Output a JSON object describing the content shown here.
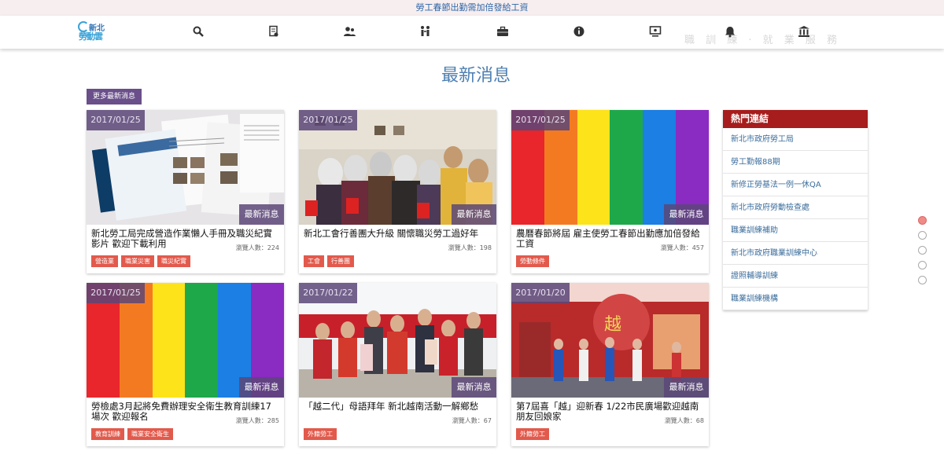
{
  "ticker": "勞工春節出勤需加倍發給工資",
  "logo": {
    "line1": "新北",
    "line2": "勞動雲"
  },
  "nav": [
    "search-icon",
    "document-icon",
    "people-icon",
    "workers-icon",
    "briefcase-icon",
    "info-icon",
    "monitor-icon",
    "bell-icon",
    "building-icon"
  ],
  "faded_text": "職 訓 練 · 就 業 服 務",
  "page_title": "最新消息",
  "more_button": "更多最新消息",
  "cards": [
    {
      "date": "2017/01/25",
      "category": "最新消息",
      "title": "新北勞工局完成營造作業懶人手冊及職災紀實影片 歡迎下載利用",
      "views": "瀏覽人數：224",
      "tags": [
        "營造業",
        "職業災害",
        "職災紀實"
      ],
      "image": "booklet-photo"
    },
    {
      "date": "2017/01/25",
      "category": "最新消息",
      "title": "新北工會行善團大升級 關懷職災勞工過好年",
      "views": "瀏覽人數：198",
      "tags": [
        "工會",
        "行善團"
      ],
      "image": "group-photo"
    },
    {
      "date": "2017/01/25",
      "category": "最新消息",
      "title": "農曆春節將屆 雇主使勞工春節出勤應加倍發給工資",
      "views": "瀏覽人數：457",
      "tags": [
        "勞動條件"
      ],
      "image": "rainbow"
    },
    {
      "date": "2017/01/25",
      "category": "最新消息",
      "title": "勞檢處3月起將免費辦理安全衛生教育訓練17場次 歡迎報名",
      "views": "瀏覽人數：285",
      "tags": [
        "教育訓練",
        "職業安全衛生"
      ],
      "image": "rainbow"
    },
    {
      "date": "2017/01/22",
      "category": "最新消息",
      "title": "「越二代」母語拜年 新北越南活動一解鄉愁",
      "views": "瀏覽人數：67",
      "tags": [
        "外籍勞工"
      ],
      "image": "event-photo"
    },
    {
      "date": "2017/01/20",
      "category": "最新消息",
      "title": "第7屆喜「越」迎新春 1/22市民廣場歡迎越南朋友回娘家",
      "views": "瀏覽人數：68",
      "tags": [
        "外籍勞工"
      ],
      "image": "stage-photo"
    }
  ],
  "sidebar": {
    "heading": "熱門連結",
    "links": [
      "新北市政府勞工局",
      "勞工勤報88期",
      "新修正勞基法一例一休QA",
      "新北市政府勞動檢查處",
      "職業訓練補助",
      "新北市政府職業訓練中心",
      "證照輔導訓練",
      "職業訓練機構"
    ]
  },
  "colors": {
    "accent": "#6a4f8a",
    "tag": "#e25a4c",
    "sidebar_head": "#a71c1c",
    "title": "#4d7fb2"
  },
  "rainbow_colors": [
    "#e8262b",
    "#f47a22",
    "#fde31a",
    "#1ea84a",
    "#1b7fe4",
    "#8a2bc2"
  ],
  "pagination": {
    "total": 5,
    "active": 1
  }
}
